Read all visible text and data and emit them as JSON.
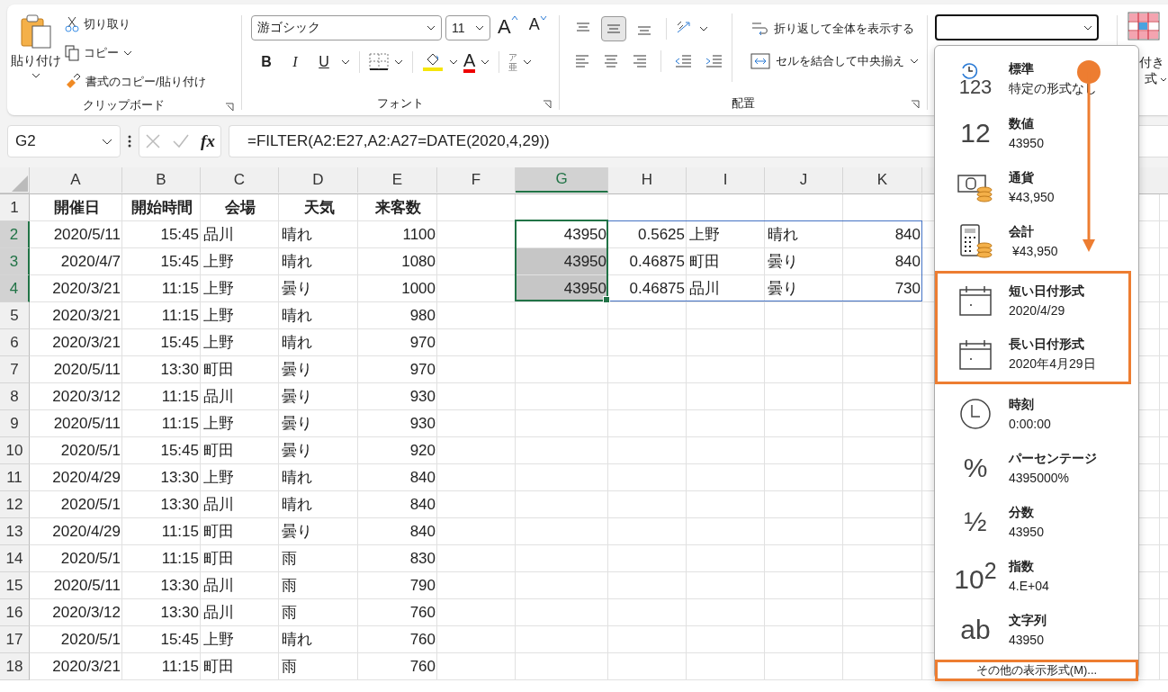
{
  "ribbon": {
    "clipboard": {
      "paste": "貼り付け",
      "cut": "切り取り",
      "copy": "コピー",
      "format_painter": "書式のコピー/貼り付け",
      "label": "クリップボード"
    },
    "font": {
      "font_name": "游ゴシック",
      "font_size": "11",
      "grow": "A",
      "shrink": "A",
      "bold": "B",
      "italic": "I",
      "underline": "U",
      "font_color": "A",
      "phonetic_top": "ア",
      "phonetic_bottom": "亜",
      "label": "フォント"
    },
    "alignment": {
      "vertical": [
        {
          "selected": false
        },
        {
          "selected": true
        },
        {
          "selected": false
        }
      ],
      "wrap_text": "折り返して全体を表示する",
      "merge_center": "セルを結合して中央揃え",
      "label": "配置"
    },
    "styles": {
      "label_top": "付き",
      "label_bottom": "式"
    }
  },
  "formula_bar": {
    "name_box": "G2",
    "fx": "fx",
    "formula": "=FILTER(A2:E27,A2:A27=DATE(2020,4,29))"
  },
  "sheet": {
    "columns": [
      {
        "label": "A",
        "selected": false
      },
      {
        "label": "B",
        "selected": false
      },
      {
        "label": "C",
        "selected": false
      },
      {
        "label": "D",
        "selected": false
      },
      {
        "label": "E",
        "selected": false
      },
      {
        "label": "F",
        "selected": false
      },
      {
        "label": "G",
        "selected": true
      },
      {
        "label": "H",
        "selected": false
      },
      {
        "label": "I",
        "selected": false
      },
      {
        "label": "J",
        "selected": false
      },
      {
        "label": "K",
        "selected": false
      }
    ],
    "rows": [
      {
        "number": "1",
        "selected": false,
        "bold": true,
        "cells": {
          "A": "開催日",
          "B": "開始時間",
          "C": "会場",
          "D": "天気",
          "E": "来客数"
        }
      },
      {
        "number": "2",
        "selected": true,
        "bold": false,
        "cells": {
          "A": "2020/5/11",
          "B": "15:45",
          "C": "品川",
          "D": "晴れ",
          "E": "1100",
          "G": "43950",
          "H": "0.5625",
          "I": "上野",
          "J": "晴れ",
          "K": "840"
        }
      },
      {
        "number": "3",
        "selected": true,
        "bold": false,
        "cells": {
          "A": "2020/4/7",
          "B": "15:45",
          "C": "上野",
          "D": "晴れ",
          "E": "1080",
          "G": "43950",
          "H": "0.46875",
          "I": "町田",
          "J": "曇り",
          "K": "840"
        }
      },
      {
        "number": "4",
        "selected": true,
        "bold": false,
        "cells": {
          "A": "2020/3/21",
          "B": "11:15",
          "C": "上野",
          "D": "曇り",
          "E": "1000",
          "G": "43950",
          "H": "0.46875",
          "I": "品川",
          "J": "曇り",
          "K": "730"
        }
      },
      {
        "number": "5",
        "selected": false,
        "bold": false,
        "cells": {
          "A": "2020/3/21",
          "B": "11:15",
          "C": "上野",
          "D": "晴れ",
          "E": "980"
        }
      },
      {
        "number": "6",
        "selected": false,
        "bold": false,
        "cells": {
          "A": "2020/3/21",
          "B": "15:45",
          "C": "上野",
          "D": "晴れ",
          "E": "970"
        }
      },
      {
        "number": "7",
        "selected": false,
        "bold": false,
        "cells": {
          "A": "2020/5/11",
          "B": "13:30",
          "C": "町田",
          "D": "曇り",
          "E": "970"
        }
      },
      {
        "number": "8",
        "selected": false,
        "bold": false,
        "cells": {
          "A": "2020/3/12",
          "B": "11:15",
          "C": "品川",
          "D": "曇り",
          "E": "930"
        }
      },
      {
        "number": "9",
        "selected": false,
        "bold": false,
        "cells": {
          "A": "2020/5/11",
          "B": "11:15",
          "C": "上野",
          "D": "曇り",
          "E": "930"
        }
      },
      {
        "number": "10",
        "selected": false,
        "bold": false,
        "cells": {
          "A": "2020/5/1",
          "B": "15:45",
          "C": "町田",
          "D": "曇り",
          "E": "920"
        }
      },
      {
        "number": "11",
        "selected": false,
        "bold": false,
        "cells": {
          "A": "2020/4/29",
          "B": "13:30",
          "C": "上野",
          "D": "晴れ",
          "E": "840"
        }
      },
      {
        "number": "12",
        "selected": false,
        "bold": false,
        "cells": {
          "A": "2020/5/1",
          "B": "13:30",
          "C": "品川",
          "D": "晴れ",
          "E": "840"
        }
      },
      {
        "number": "13",
        "selected": false,
        "bold": false,
        "cells": {
          "A": "2020/4/29",
          "B": "11:15",
          "C": "町田",
          "D": "曇り",
          "E": "840"
        }
      },
      {
        "number": "14",
        "selected": false,
        "bold": false,
        "cells": {
          "A": "2020/5/1",
          "B": "11:15",
          "C": "町田",
          "D": "雨",
          "E": "830"
        }
      },
      {
        "number": "15",
        "selected": false,
        "bold": false,
        "cells": {
          "A": "2020/5/11",
          "B": "13:30",
          "C": "品川",
          "D": "雨",
          "E": "790"
        }
      },
      {
        "number": "16",
        "selected": false,
        "bold": false,
        "cells": {
          "A": "2020/3/12",
          "B": "13:30",
          "C": "品川",
          "D": "雨",
          "E": "760"
        }
      },
      {
        "number": "17",
        "selected": false,
        "bold": false,
        "cells": {
          "A": "2020/5/1",
          "B": "15:45",
          "C": "上野",
          "D": "晴れ",
          "E": "760"
        }
      },
      {
        "number": "18",
        "selected": false,
        "bold": false,
        "cells": {
          "A": "2020/3/21",
          "B": "11:15",
          "C": "町田",
          "D": "雨",
          "E": "760"
        }
      }
    ]
  },
  "format_menu": {
    "items": [
      {
        "kind": "general",
        "icon_text": "123",
        "title": "標準",
        "example": "特定の形式なし",
        "highlighted": false
      },
      {
        "kind": "number",
        "icon_text": "12",
        "title": "数値",
        "example": "43950",
        "highlighted": false
      },
      {
        "kind": "currency",
        "title": "通貨",
        "example": "¥43,950",
        "highlighted": false
      },
      {
        "kind": "accounting",
        "title": "会計",
        "example": " ¥43,950",
        "highlighted": false
      },
      {
        "kind": "date",
        "title": "短い日付形式",
        "example": "2020/4/29",
        "highlighted": true
      },
      {
        "kind": "date",
        "title": "長い日付形式",
        "example": "2020年4月29日",
        "highlighted": true
      },
      {
        "kind": "time",
        "title": "時刻",
        "example": "0:00:00",
        "highlighted": false
      },
      {
        "kind": "glyph",
        "icon_text": "%",
        "title": "パーセンテージ",
        "example": "4395000%",
        "highlighted": false
      },
      {
        "kind": "glyph",
        "icon_text": "½",
        "title": "分数",
        "example": "43950",
        "highlighted": false
      },
      {
        "kind": "glyph",
        "icon_text": "10$^{2}$",
        "title": "指数",
        "example": "4.E+04",
        "highlighted": false
      },
      {
        "kind": "glyph",
        "icon_text": "ab",
        "title": "文字列",
        "example": "43950",
        "highlighted": false
      }
    ],
    "more": {
      "label": "その他の表示形式(M)...",
      "highlighted": true
    }
  }
}
